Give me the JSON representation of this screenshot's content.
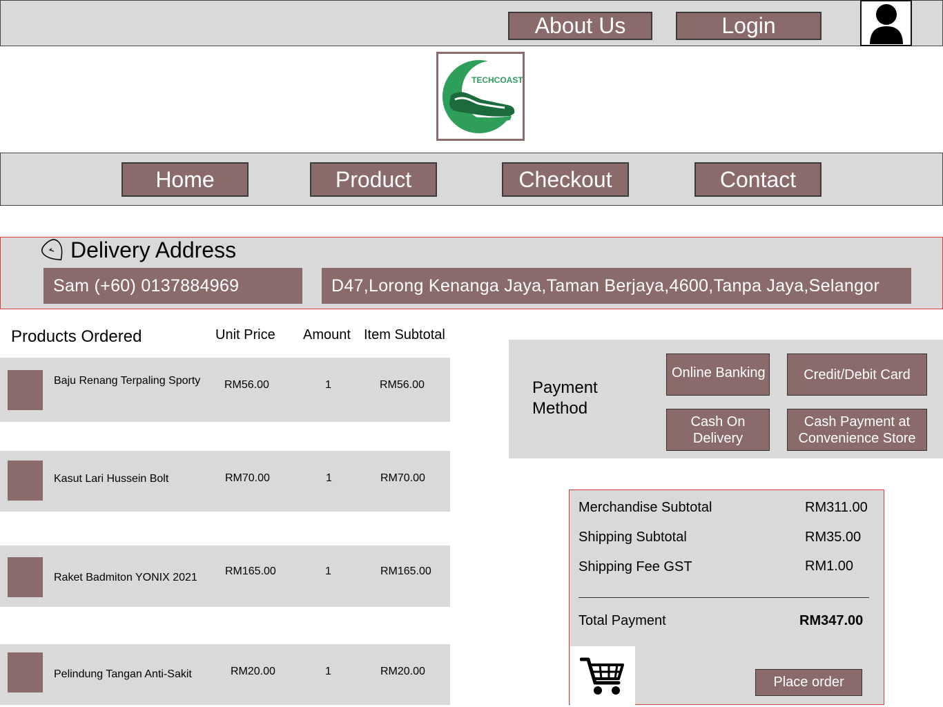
{
  "header": {
    "about_label": "About Us",
    "login_label": "Login",
    "logo_text": "TECHCOAST"
  },
  "nav": {
    "home": "Home",
    "product": "Product",
    "checkout": "Checkout",
    "contact": "Contact"
  },
  "delivery": {
    "title": "Delivery Address",
    "name_phone": "Sam (+60) 0137884969",
    "address": "D47,Lorong Kenanga Jaya,Taman Berjaya,4600,Tanpa Jaya,Selangor"
  },
  "products": {
    "headers": {
      "product": "Products Ordered",
      "unit_price": "Unit Price",
      "amount": "Amount",
      "subtotal": "Item Subtotal"
    },
    "items": [
      {
        "name": "Baju Renang Terpaling Sporty",
        "price": "RM56.00",
        "amount": "1",
        "subtotal": "RM56.00"
      },
      {
        "name": "Kasut Lari Hussein Bolt",
        "price": "RM70.00",
        "amount": "1",
        "subtotal": "RM70.00"
      },
      {
        "name": "Raket Badmiton YONIX 2021",
        "price": "RM165.00",
        "amount": "1",
        "subtotal": "RM165.00"
      },
      {
        "name": "Pelindung Tangan Anti-Sakit",
        "price": "RM20.00",
        "amount": "1",
        "subtotal": "RM20.00"
      }
    ]
  },
  "payment": {
    "title": "Payment Method",
    "options": [
      "Online Banking",
      "Credit/Debit Card",
      "Cash On Delivery",
      "Cash Payment at Convenience Store"
    ]
  },
  "summary": {
    "merch_label": "Merchandise Subtotal",
    "merch_value": "RM311.00",
    "ship_label": "Shipping Subtotal",
    "ship_value": "RM35.00",
    "gst_label": "Shipping Fee GST",
    "gst_value": "RM1.00",
    "total_label": "Total Payment",
    "total_value": "RM347.00",
    "place_order": "Place order"
  },
  "colors": {
    "button_bg": "#8b6a6a",
    "panel_bg": "#d9d9d9",
    "accent_border": "#d04040",
    "logo_green": "#2e9e5b"
  }
}
